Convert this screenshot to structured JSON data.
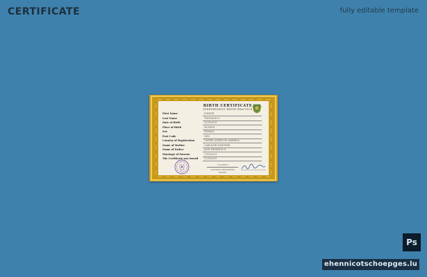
{
  "header": {
    "title": "CERTIFICATE",
    "subtitle": "fully editable template"
  },
  "certificate": {
    "heading": "BIRTH CERTIFICATE",
    "subheading": "INDEPENDENT BIRTH PRACTICE",
    "fields": [
      {
        "label": "First Name",
        "value": "JOHNNE"
      },
      {
        "label": "Last Name",
        "value": "THOMSON N"
      },
      {
        "label": "Date of Birth",
        "value": "11/10/2015"
      },
      {
        "label": "Place of Birth",
        "value": "MUNICH"
      },
      {
        "label": "Sex",
        "value": "FEMALE"
      },
      {
        "label": "Post Code",
        "value": "1415"
      },
      {
        "label": "Country of Registration",
        "value": "UNITED STATES OF AMERICA"
      },
      {
        "label": "Name of Mother",
        "value": "CAROLINE KILBURNE"
      },
      {
        "label": "Name of Father",
        "value": "JACK THOMSON N"
      },
      {
        "label": "Marriage of Parents",
        "value": "17/03/2013"
      },
      {
        "label": "The Certificate was issued",
        "value": "11/10/2015"
      }
    ],
    "issue_date": "11/10/2015",
    "signature_caption": "NATIONAL REGISTRAR OFFICE"
  },
  "badges": {
    "ps_label": "Ps",
    "watermark": "ehennicotschoepges.lu"
  },
  "colors": {
    "background": "#3f81ad",
    "frame_gold": "#c99a1c",
    "paper": "#f3efe3",
    "seal": "#7c5aa6",
    "signature_ink": "#2c4fa3"
  }
}
